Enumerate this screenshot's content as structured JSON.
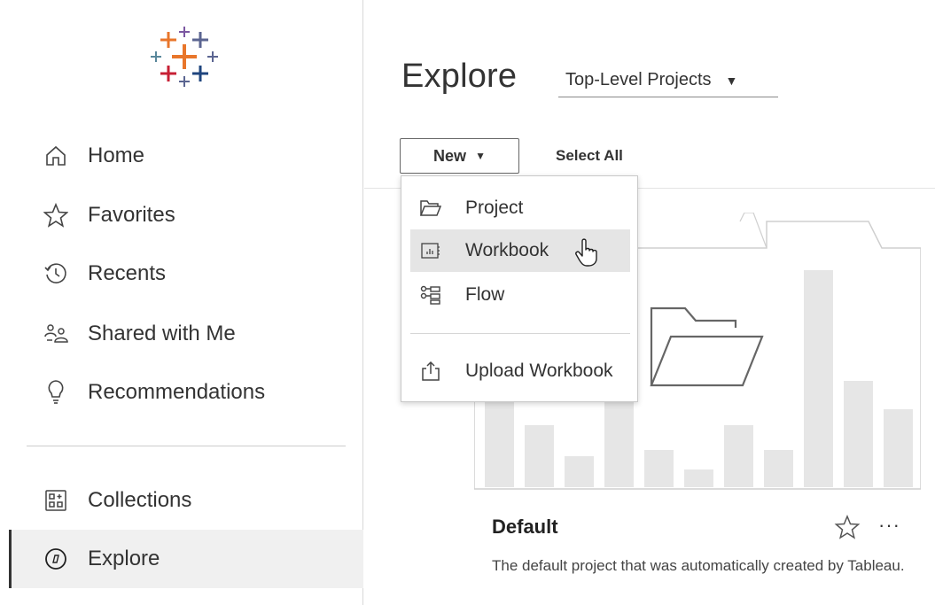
{
  "sidebar": {
    "items": [
      {
        "label": "Home",
        "icon": "home-icon"
      },
      {
        "label": "Favorites",
        "icon": "star-icon"
      },
      {
        "label": "Recents",
        "icon": "history-icon"
      },
      {
        "label": "Shared with Me",
        "icon": "shared-users-icon"
      },
      {
        "label": "Recommendations",
        "icon": "lightbulb-icon"
      },
      {
        "label": "Collections",
        "icon": "collections-icon"
      },
      {
        "label": "Explore",
        "icon": "compass-icon",
        "active": true
      }
    ]
  },
  "main": {
    "title": "Explore",
    "project_filter": "Top-Level Projects",
    "toolbar": {
      "new_label": "New",
      "select_all_label": "Select All"
    },
    "new_menu": {
      "items": [
        {
          "label": "Project",
          "icon": "folder-icon"
        },
        {
          "label": "Workbook",
          "icon": "workbook-icon",
          "hovered": true
        },
        {
          "label": "Flow",
          "icon": "flow-icon"
        },
        {
          "label": "Upload Workbook",
          "icon": "upload-icon"
        }
      ]
    },
    "card": {
      "name": "Default",
      "description": "The default project that was automatically created by Tableau."
    }
  },
  "colors": {
    "active_bg": "#f0f0f0",
    "hover_bg": "#e5e5e5",
    "text": "#333333",
    "card_art": "#e6e6e6"
  }
}
